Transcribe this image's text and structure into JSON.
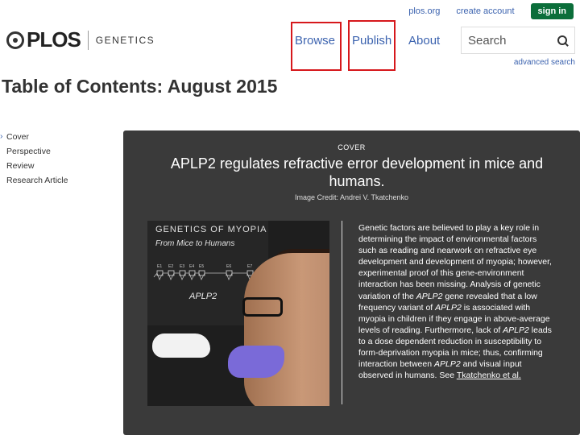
{
  "header": {
    "util_links": [
      "plos.org",
      "create account"
    ],
    "signin_label": "sign in",
    "logo_text": "PLOS",
    "logo_sub": "GENETICS",
    "nav": [
      "Browse",
      "Publish",
      "About"
    ],
    "search_placeholder": "Search",
    "advanced_search": "advanced search"
  },
  "page_title": "Table of Contents: August 2015",
  "toc": [
    "Cover",
    "Perspective",
    "Review",
    "Research Article"
  ],
  "cover": {
    "kicker": "COVER",
    "headline": "APLP2 regulates refractive error development in mice and humans.",
    "credit": "Image Credit: Andrei V. Tkatchenko",
    "figure": {
      "title": "GENETICS OF MYOPIA",
      "subtitle": "From Mice to Humans",
      "label": "APLP2",
      "exon_labels": [
        "E1",
        "E2",
        "E3",
        "E4",
        "E5",
        "E6",
        "E7"
      ]
    },
    "abstract": {
      "p1": "Genetic factors are believed to play a key role in determining the impact of environmental factors such as reading and nearwork on refractive eye development and development of myopia; however, experimental proof of this gene-environment interaction has been missing. Analysis of genetic variation of the ",
      "g1": "APLP2",
      "p2": " gene revealed that a low frequency variant of ",
      "g2": "APLP2",
      "p3": " is associated with myopia in children if they engage in above-average levels of reading. Furthermore, lack of ",
      "g3": "APLP2",
      "p4": " leads to a dose dependent reduction in susceptibility to form-deprivation myopia in mice; thus, confirming interaction between ",
      "g4": "APLP2",
      "p5": " and visual input observed in humans. See ",
      "link": "Tkatchenko et al."
    }
  },
  "colors": {
    "link": "#3c63af",
    "highlight": "#d6181c",
    "signin": "#0b6e3a",
    "panel": "#3a3a3a"
  }
}
